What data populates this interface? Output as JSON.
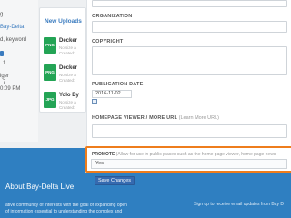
{
  "left_column": {
    "lines": [
      "g",
      "Bay-Delta",
      "d, keyword"
    ],
    "meta": [
      "1",
      "iger",
      "7",
      "0:09 PM"
    ]
  },
  "uploads": {
    "title": "New Uploads",
    "items": [
      {
        "thumb": "PNG",
        "name": "Decker",
        "meta1": "No size a",
        "meta2": "Created:"
      },
      {
        "thumb": "PNG",
        "name": "Decker",
        "meta1": "No size a",
        "meta2": "Created:"
      },
      {
        "thumb": "JPG",
        "name": "Yolo By",
        "meta1": "No size a",
        "meta2": "Created:"
      }
    ]
  },
  "form": {
    "organization_label": "ORGANIZATION",
    "copyright_label": "COPYRIGHT",
    "publication_date_label": "PUBLICATION DATE",
    "publication_date_value": "2016-11-02",
    "homepage_label": "HOMEPAGE VIEWER / MORE URL",
    "homepage_note": "(Learn More URL)",
    "promote_label": "PROMOTE",
    "promote_note": "(Allow for use in public places such as the home page viewer, home page news",
    "promote_value": "Yes",
    "save_label": "Save Changes"
  },
  "footer": {
    "title": "About Bay-Delta Live",
    "desc_line1": "ative community of interests with the goal of expanding open",
    "desc_line2": "of information essential to understanding the complex and",
    "signup": "Sign up to receive email updates from Bay D"
  },
  "colors": {
    "accent": "#ee7d1c",
    "primary": "#356ab0",
    "footer_bg": "#2f7fc1",
    "file_green": "#23a455"
  }
}
